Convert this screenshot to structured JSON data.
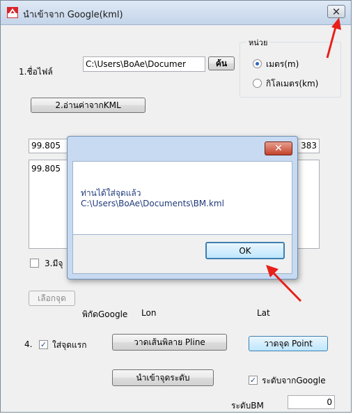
{
  "window": {
    "title": "นำเข้าจาก Google(kml)",
    "close_label": "✕"
  },
  "file": {
    "label": "1.ชื่อไฟล์",
    "path": "C:\\Users\\BoAe\\Documer",
    "browse_label": "ค้น"
  },
  "unit": {
    "group_label": "หน่วย",
    "options": [
      {
        "label": "เมตร(m)",
        "selected": true
      },
      {
        "label": "กิโลเมตร(km)",
        "selected": false
      }
    ]
  },
  "read_button_label": "2.อ่านค่าจากKML",
  "coords": {
    "input_left_value": "99.805",
    "input_right_value": "383",
    "list_value": "99.805"
  },
  "step3": {
    "checkbox_label": "3.มีจุ",
    "select_point_label": "เลือกจุด"
  },
  "columns": {
    "google_label": "พิกัดGoogle",
    "lon_label": "Lon",
    "lat_label": "Lat"
  },
  "step4": {
    "label": "4.",
    "first_point_label": "ใส่จุดแรก",
    "first_point_checked": true,
    "draw_pline_label": "วาดเส้นพิลาย Pline",
    "draw_point_label": "วาดจุด Point"
  },
  "import_level_label": "นำเข้าจุดระดับ",
  "level_from_google": {
    "label": "ระดับจากGoogle",
    "checked": true
  },
  "bm": {
    "label": "ระดับBM",
    "value": "0"
  },
  "dialog": {
    "close_label": "✕",
    "message_line1": "ท่านได้ใส่จุดแล้ว",
    "message_line2": "C:\\Users\\BoAe\\Documents\\BM.kml",
    "ok_label": "OK"
  },
  "colors": {
    "annotation_arrow": "#e8201a",
    "dialog_frame": "#c7daf1",
    "dialog_close": "#c2422c"
  }
}
